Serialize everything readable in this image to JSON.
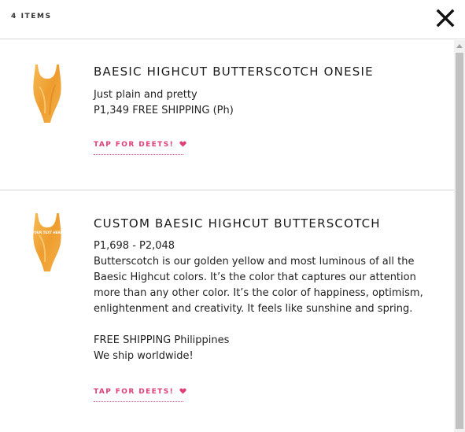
{
  "header": {
    "item_count": "4 ITEMS",
    "close_icon": "close-x-icon"
  },
  "products": [
    {
      "title": "BAESIC HIGHCUT BUTTERSCOTCH ONESIE",
      "description": [
        "Just plain and pretty",
        "P1,349 FREE SHIPPING (Ph)"
      ],
      "cta_label": "TAP FOR DEETS!",
      "image_icon": "swimsuit-icon"
    },
    {
      "title": "CUSTOM BAESIC HIGHCUT BUTTERSCOTCH",
      "price": "P1,698 - P2,048",
      "description": "Butterscotch is our golden yellow and most luminous of all the Baesic Highcut colors. It’s the color that captures our attention more than any other color. It’s the color of happiness, optimism, enlightenment and creativity. It feels like sunshine and spring.",
      "shipping": "FREE SHIPPING Philippines",
      "worldwide": "We ship worldwide!",
      "swimsuit_print": "YOUR TEXT HERE",
      "cta_label": "TAP FOR DEETS!",
      "image_icon": "custom-swimsuit-icon"
    }
  ],
  "colors": {
    "accent": "#e0407a",
    "swimsuit": "#f2a83a",
    "divider": "#d3d3d3"
  }
}
